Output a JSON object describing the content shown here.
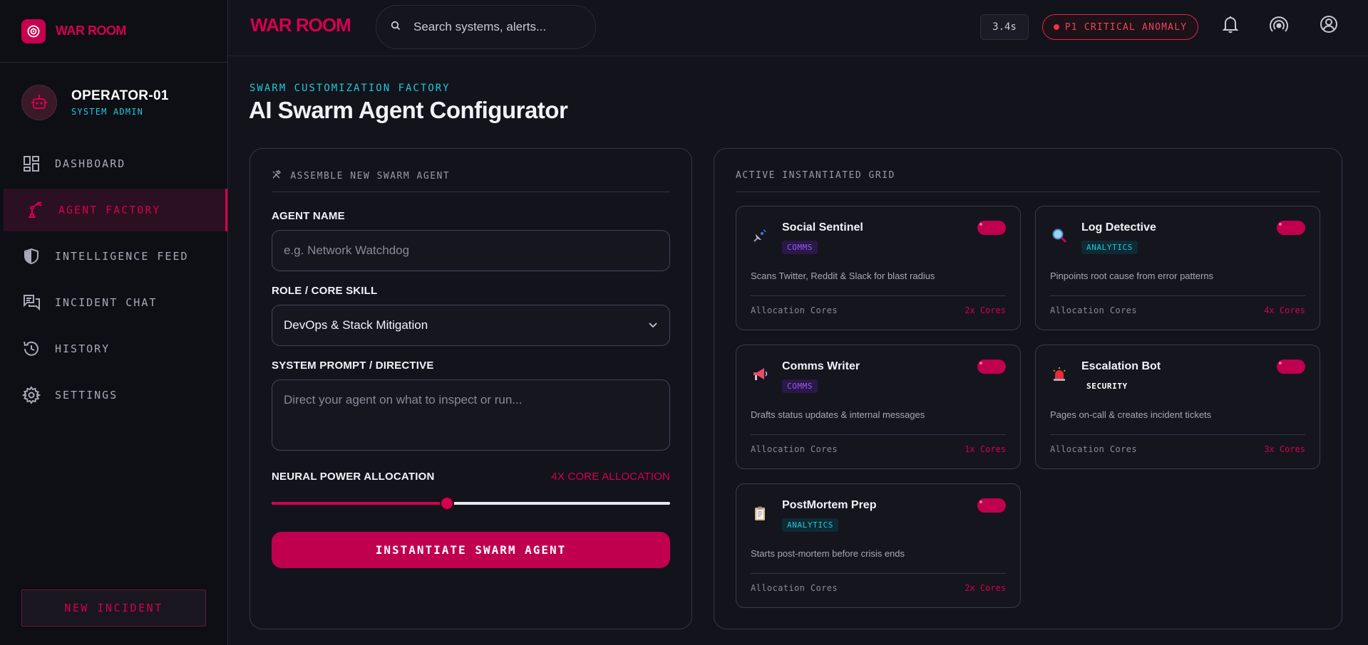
{
  "brand": {
    "name": "WAR ROOM"
  },
  "operator": {
    "name": "OPERATOR-01",
    "role": "SYSTEM ADMIN"
  },
  "sidebar": {
    "items": [
      {
        "label": "DASHBOARD",
        "icon": "dashboard-icon"
      },
      {
        "label": "AGENT FACTORY",
        "icon": "robot-arm-icon",
        "active": true
      },
      {
        "label": "INTELLIGENCE FEED",
        "icon": "shield-icon"
      },
      {
        "label": "INCIDENT CHAT",
        "icon": "chat-icon"
      },
      {
        "label": "HISTORY",
        "icon": "history-icon"
      },
      {
        "label": "SETTINGS",
        "icon": "gear-icon"
      }
    ],
    "new_incident_label": "NEW INCIDENT"
  },
  "header": {
    "title": "WAR ROOM",
    "search_placeholder": "Search systems, alerts...",
    "latency": "3.4s",
    "anomaly": "P1 CRITICAL ANOMALY"
  },
  "main": {
    "eyebrow": "SWARM CUSTOMIZATION FACTORY",
    "title": "AI Swarm Agent Configurator"
  },
  "form": {
    "heading": "ASSEMBLE NEW SWARM AGENT",
    "heading_icon": "tools-icon",
    "agent_name_label": "AGENT NAME",
    "agent_name_placeholder": "e.g. Network Watchdog",
    "role_label": "ROLE / CORE SKILL",
    "role_value": "DevOps & Stack Mitigation",
    "prompt_label": "SYSTEM PROMPT / DIRECTIVE",
    "prompt_placeholder": "Direct your agent on what to inspect or run...",
    "power_label": "NEURAL POWER ALLOCATION",
    "power_value_label": "4X CORE ALLOCATION",
    "power_fraction": 0.44,
    "submit_label": "INSTANTIATE SWARM AGENT"
  },
  "grid": {
    "heading": "ACTIVE INSTANTIATED GRID",
    "alloc_label": "Allocation Cores",
    "cards": [
      {
        "name": "Social Sentinel",
        "badge": "COMMS",
        "badge_type": "comms",
        "icon": "satellite-icon",
        "desc": "Scans Twitter, Reddit & Slack for blast radius",
        "cores": "2x Cores",
        "enabled": true
      },
      {
        "name": "Log Detective",
        "badge": "ANALYTICS",
        "badge_type": "analytics",
        "icon": "magnifier-icon",
        "desc": "Pinpoints root cause from error patterns",
        "cores": "4x Cores",
        "enabled": true
      },
      {
        "name": "Comms Writer",
        "badge": "COMMS",
        "badge_type": "comms",
        "icon": "megaphone-icon",
        "desc": "Drafts status updates & internal messages",
        "cores": "1x Cores",
        "enabled": true
      },
      {
        "name": "Escalation Bot",
        "badge": "SECURITY",
        "badge_type": "security",
        "icon": "siren-icon",
        "desc": "Pages on-call & creates incident tickets",
        "cores": "3x Cores",
        "enabled": true
      },
      {
        "name": "PostMortem Prep",
        "badge": "ANALYTICS",
        "badge_type": "analytics",
        "icon": "clipboard-icon",
        "desc": "Starts post-mortem before crisis ends",
        "cores": "2x Cores",
        "enabled": true
      }
    ]
  },
  "colors": {
    "accent": "#d4004f",
    "cyan": "#1ec8d8",
    "purple": "#9a5af0",
    "background": "#13131c",
    "sidebar": "#0e0e15"
  }
}
